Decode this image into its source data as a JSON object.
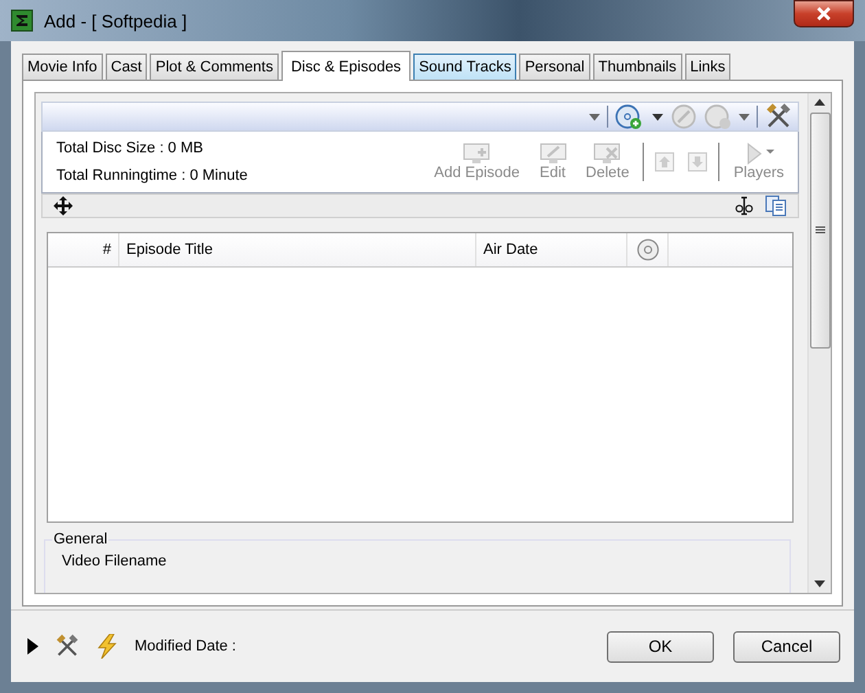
{
  "window": {
    "title": "Add - [ Softpedia ]"
  },
  "tabs": [
    {
      "label": "Movie Info",
      "selected": false,
      "highlighted": false
    },
    {
      "label": "Cast",
      "selected": false,
      "highlighted": false
    },
    {
      "label": "Plot & Comments",
      "selected": false,
      "highlighted": false
    },
    {
      "label": "Disc & Episodes",
      "selected": true,
      "highlighted": false
    },
    {
      "label": "Sound Tracks",
      "selected": false,
      "highlighted": true
    },
    {
      "label": "Personal",
      "selected": false,
      "highlighted": false
    },
    {
      "label": "Thumbnails",
      "selected": false,
      "highlighted": false
    },
    {
      "label": "Links",
      "selected": false,
      "highlighted": false
    }
  ],
  "summary": [
    "Total Disc Size : 0 MB",
    "Total Runningtime : 0 Minute"
  ],
  "actions": [
    {
      "label": "Add Episode",
      "kind": "add",
      "disabled": true
    },
    {
      "label": "Edit",
      "kind": "edit",
      "disabled": true
    },
    {
      "label": "Delete",
      "kind": "delete",
      "disabled": true
    },
    {
      "label": "Players",
      "kind": "play",
      "disabled": true
    }
  ],
  "table": {
    "columns": [
      "#",
      "Episode Title",
      "Air Date"
    ]
  },
  "general": {
    "title": "General",
    "fields": [
      "Video Filename"
    ]
  },
  "footer": {
    "label": "Modified Date :"
  },
  "buttons": [
    "OK",
    "Cancel"
  ]
}
